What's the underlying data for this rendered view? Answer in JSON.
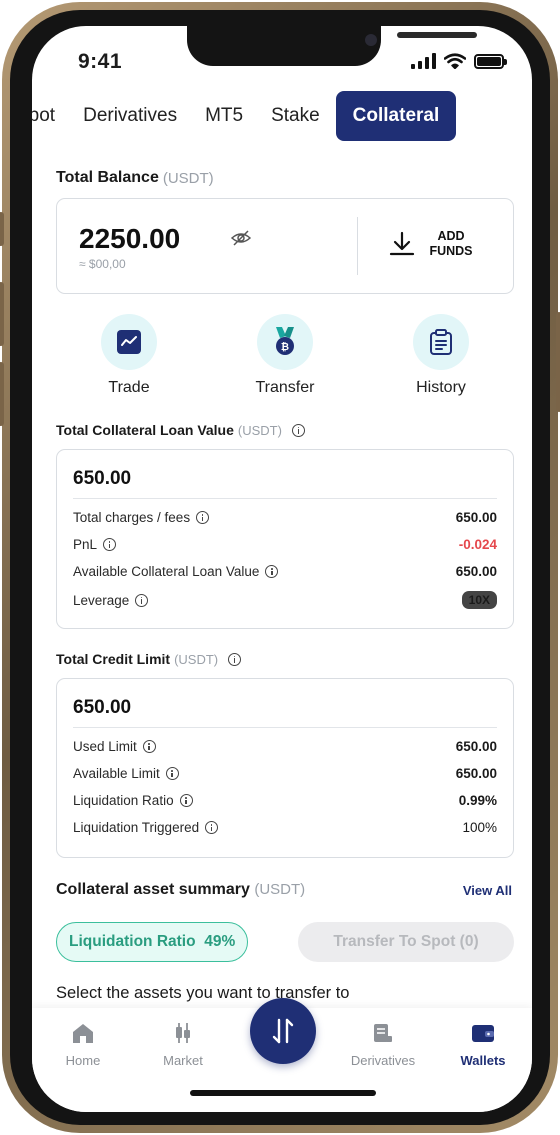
{
  "status_bar": {
    "time": "9:41"
  },
  "tabs": [
    {
      "label": "Spot",
      "active": false
    },
    {
      "label": "Derivatives",
      "active": false
    },
    {
      "label": "MT5",
      "active": false
    },
    {
      "label": "Stake",
      "active": false
    },
    {
      "label": "Collateral",
      "active": true
    }
  ],
  "balance": {
    "title": "Total Balance",
    "unit": "(USDT)",
    "amount": "2250.00",
    "approx": "≈ $00,00",
    "add_funds_label": "ADD FUNDS"
  },
  "actions": [
    {
      "label": "Trade",
      "icon": "chart-icon"
    },
    {
      "label": "Transfer",
      "icon": "medal-icon"
    },
    {
      "label": "History",
      "icon": "clipboard-icon"
    }
  ],
  "collateral_loan": {
    "title": "Total Collateral Loan Value",
    "unit": "(USDT)",
    "value": "650.00",
    "rows": [
      {
        "label": "Total charges / fees",
        "value": "650.00"
      },
      {
        "label": "PnL",
        "value": "-0.024"
      },
      {
        "label": "Available Collateral Loan Value",
        "value": "650.00"
      },
      {
        "label": "Leverage",
        "value": "10X"
      }
    ]
  },
  "credit_limit": {
    "title": "Total Credit Limit",
    "unit": "(USDT)",
    "value": "650.00",
    "rows": [
      {
        "label": "Used Limit",
        "value": "650.00"
      },
      {
        "label": "Available Limit",
        "value": "650.00"
      },
      {
        "label": "Liquidation Ratio",
        "value": "0.99%"
      },
      {
        "label": "Liquidation Triggered",
        "value": "100%"
      }
    ]
  },
  "summary": {
    "title": "Collateral asset summary",
    "unit": "(USDT)",
    "view_all": "View All",
    "liquidation_label": "Liquidation Ratio",
    "liquidation_value": "49%",
    "transfer_button": "Transfer To Spot (0)",
    "select_text": "Select the assets you want to transfer to"
  },
  "bottom_nav": [
    {
      "label": "Home",
      "active": false
    },
    {
      "label": "Market",
      "active": false
    },
    {
      "label": "Derivatives",
      "active": false
    },
    {
      "label": "Wallets",
      "active": true
    }
  ],
  "colors": {
    "brand": "#1f2f75",
    "negative": "#e5484d",
    "success": "#2a9d80",
    "action_bg": "#e2f6f8"
  }
}
